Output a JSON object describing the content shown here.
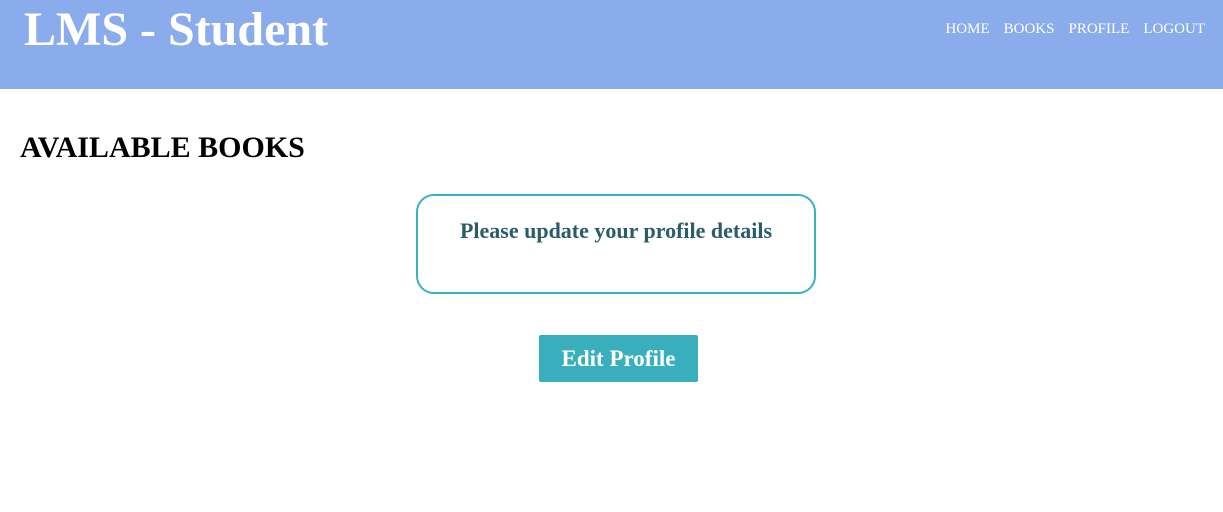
{
  "header": {
    "brand": "LMS - Student",
    "nav": [
      {
        "label": "HOME"
      },
      {
        "label": "BOOKS"
      },
      {
        "label": "PROFILE"
      },
      {
        "label": "LOGOUT"
      }
    ]
  },
  "main": {
    "title": "AVAILABLE BOOKS",
    "notice": "Please update your profile details",
    "edit_button_label": "Edit Profile"
  },
  "colors": {
    "header_bg": "#8aacec",
    "accent": "#39afbe",
    "notice_text": "#2a5c69"
  }
}
